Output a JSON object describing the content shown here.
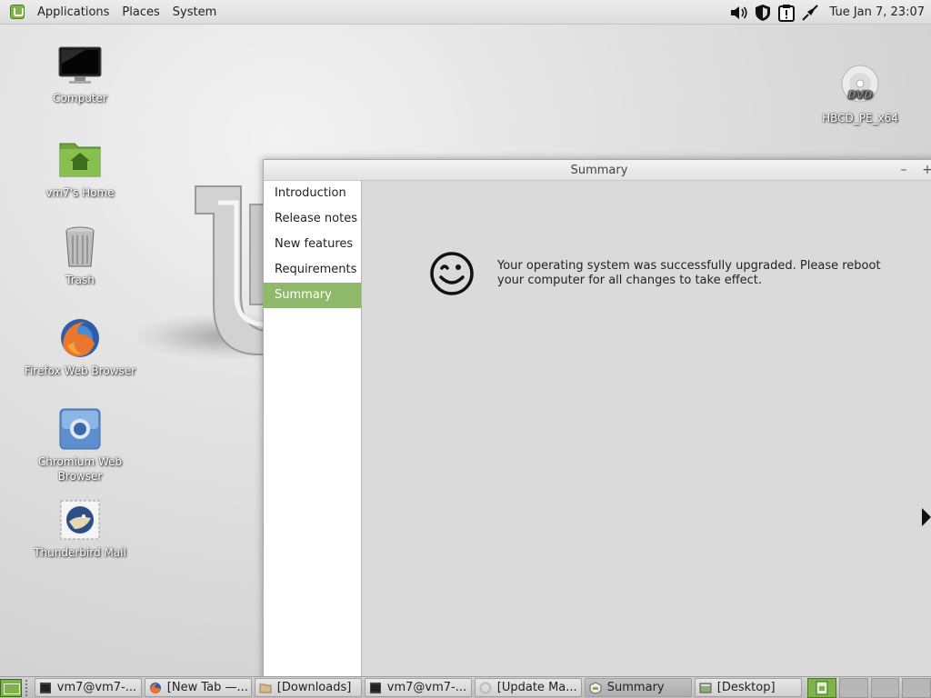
{
  "top_panel": {
    "menus": [
      "Applications",
      "Places",
      "System"
    ],
    "clock": "Tue Jan  7, 23:07",
    "tray_icons": [
      "volume-icon",
      "shield-icon",
      "update-warning-icon",
      "network-icon"
    ]
  },
  "desktop": {
    "icons": [
      {
        "label": "Computer",
        "icon": "monitor-icon"
      },
      {
        "label": "vm7's Home",
        "icon": "home-folder-icon"
      },
      {
        "label": "Trash",
        "icon": "trash-icon"
      },
      {
        "label": "Firefox Web Browser",
        "icon": "firefox-icon"
      },
      {
        "label": "Chromium Web Browser",
        "icon": "chromium-icon"
      },
      {
        "label": "Thunderbird Mail",
        "icon": "thunderbird-icon"
      },
      {
        "label": "HBCD_PE_x64",
        "icon": "dvd-icon"
      }
    ]
  },
  "window": {
    "title": "Summary",
    "controls": [
      "–",
      "+"
    ],
    "sidebar": [
      "Introduction",
      "Release notes",
      "New features",
      "Requirements",
      "Summary"
    ],
    "active_item": "Summary",
    "message": "Your operating system was successfully upgraded. Please reboot your computer for all changes to take effect."
  },
  "taskbar": {
    "tasks": [
      {
        "label": "vm7@vm7-...",
        "icon": "terminal-icon"
      },
      {
        "label": "[New Tab —...",
        "icon": "firefox-icon"
      },
      {
        "label": "[Downloads]",
        "icon": "folder-icon"
      },
      {
        "label": "vm7@vm7-...",
        "icon": "terminal-icon"
      },
      {
        "label": "[Update Ma...",
        "icon": "update-manager-icon"
      },
      {
        "label": "Summary",
        "icon": "mint-upgrade-icon"
      },
      {
        "label": "[Desktop]",
        "icon": "desktop-icon"
      }
    ],
    "active_task": "Summary"
  },
  "colors": {
    "accent": "#8eb96b",
    "mint_green": "#7eb24b"
  }
}
